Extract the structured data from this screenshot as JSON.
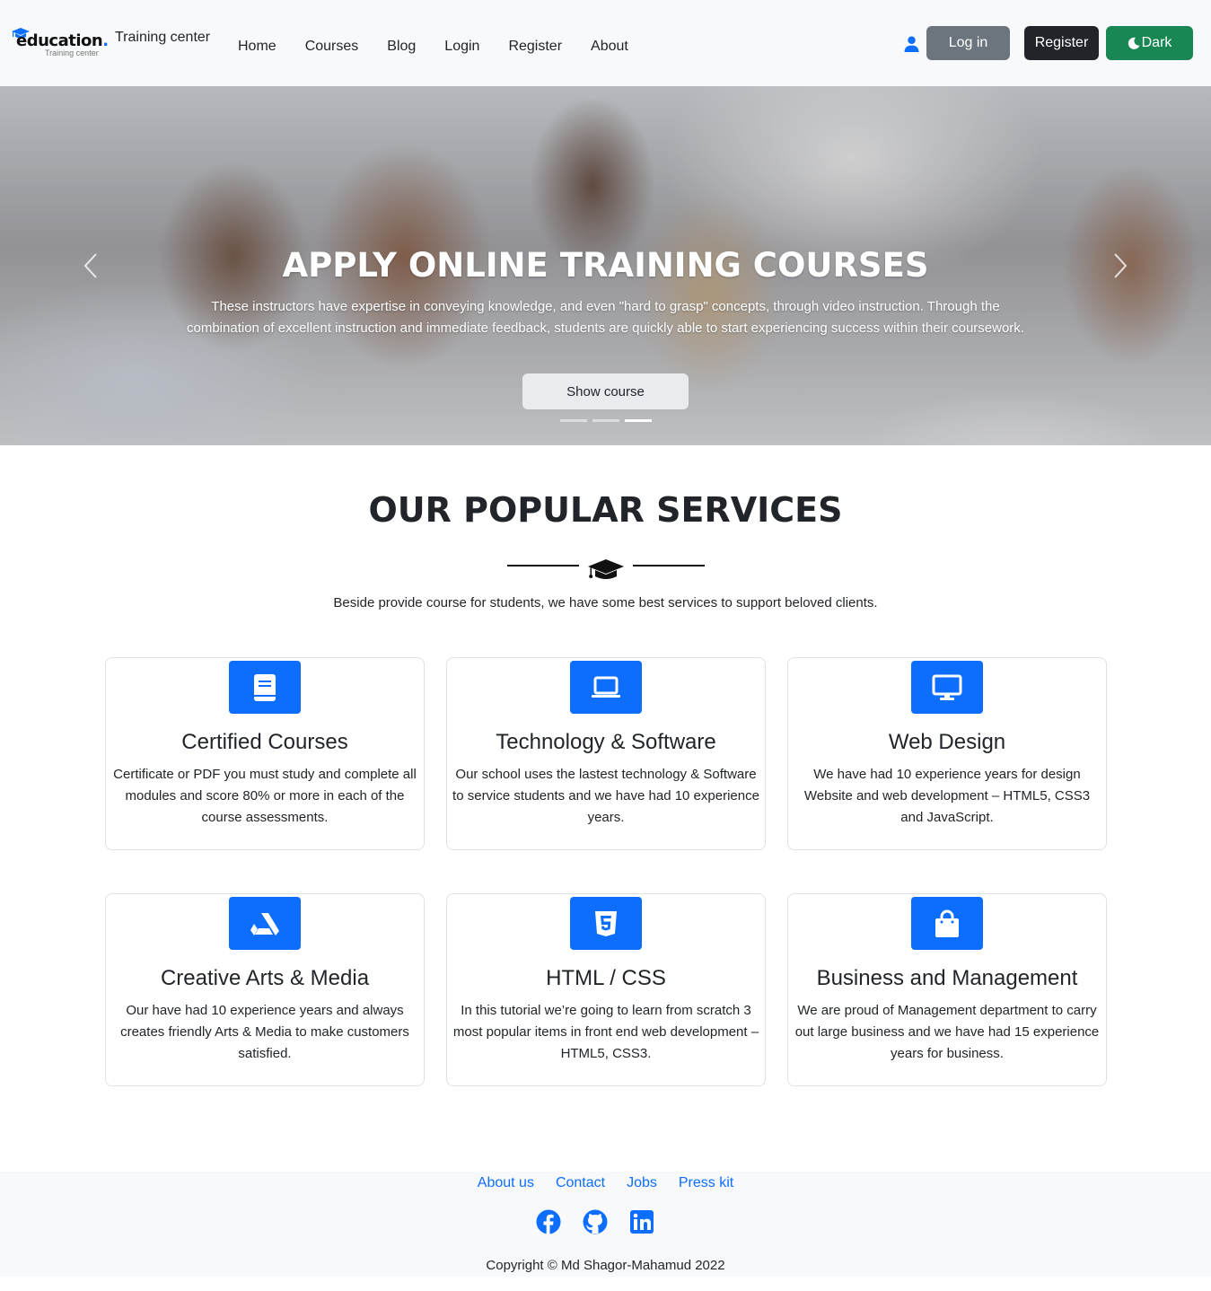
{
  "brand": {
    "logo_text": "education",
    "logo_sub": "Training center",
    "tagline": "Training center"
  },
  "nav": {
    "links": [
      "Home",
      "Courses",
      "Blog",
      "Login",
      "Register",
      "About"
    ],
    "login_label": "Log in",
    "register_label": "Register",
    "theme_label": "Dark"
  },
  "hero": {
    "title": "APPLY ONLINE TRAINING COURSES",
    "text": "These instructors have expertise in conveying knowledge, and even \"hard to grasp\" concepts, through video instruction. Through the combination of excellent instruction and immediate feedback, students are quickly able to start experiencing success within their coursework.",
    "button_label": "Show course",
    "slides_count": 3,
    "active_slide": 3
  },
  "services": {
    "title": "OUR POPULAR SERVICES",
    "subtitle": "Beside provide course for students, we have some best services to support beloved clients.",
    "cards": [
      {
        "icon": "book-icon",
        "title": "Certified Courses",
        "text": "Certificate or PDF you must study and complete all modules and score 80% or more in each of the course assessments."
      },
      {
        "icon": "laptop-icon",
        "title": "Technology & Software",
        "text": "Our school uses the lastest technology & Software to service students and we have had 10 experience years."
      },
      {
        "icon": "monitor-icon",
        "title": "Web Design",
        "text": "We have had 10 experience years for design Website and web development – HTML5, CSS3 and JavaScript."
      },
      {
        "icon": "artstation-icon",
        "title": "Creative Arts & Media",
        "text": "Our have had 10 experience years and always creates friendly Arts & Media to make customers satisfied."
      },
      {
        "icon": "html5-icon",
        "title": "HTML / CSS",
        "text": "In this tutorial we’re going to learn from scratch 3 most popular items in front end web development – HTML5, CSS3."
      },
      {
        "icon": "shopping-bag-icon",
        "title": "Business and Management",
        "text": "We are proud of Management department to carry out large business and we have had 15 experience years for business."
      }
    ]
  },
  "footer": {
    "links": [
      "About us",
      "Contact",
      "Jobs",
      "Press kit"
    ],
    "social": [
      "facebook-icon",
      "github-icon",
      "linkedin-icon"
    ],
    "copyright": "Copyright © Md Shagor-Mahamud 2022"
  },
  "colors": {
    "primary": "#0d6efd",
    "secondary": "#6c757d",
    "dark": "#212529",
    "success": "#198754",
    "light": "#f8f9fa"
  }
}
